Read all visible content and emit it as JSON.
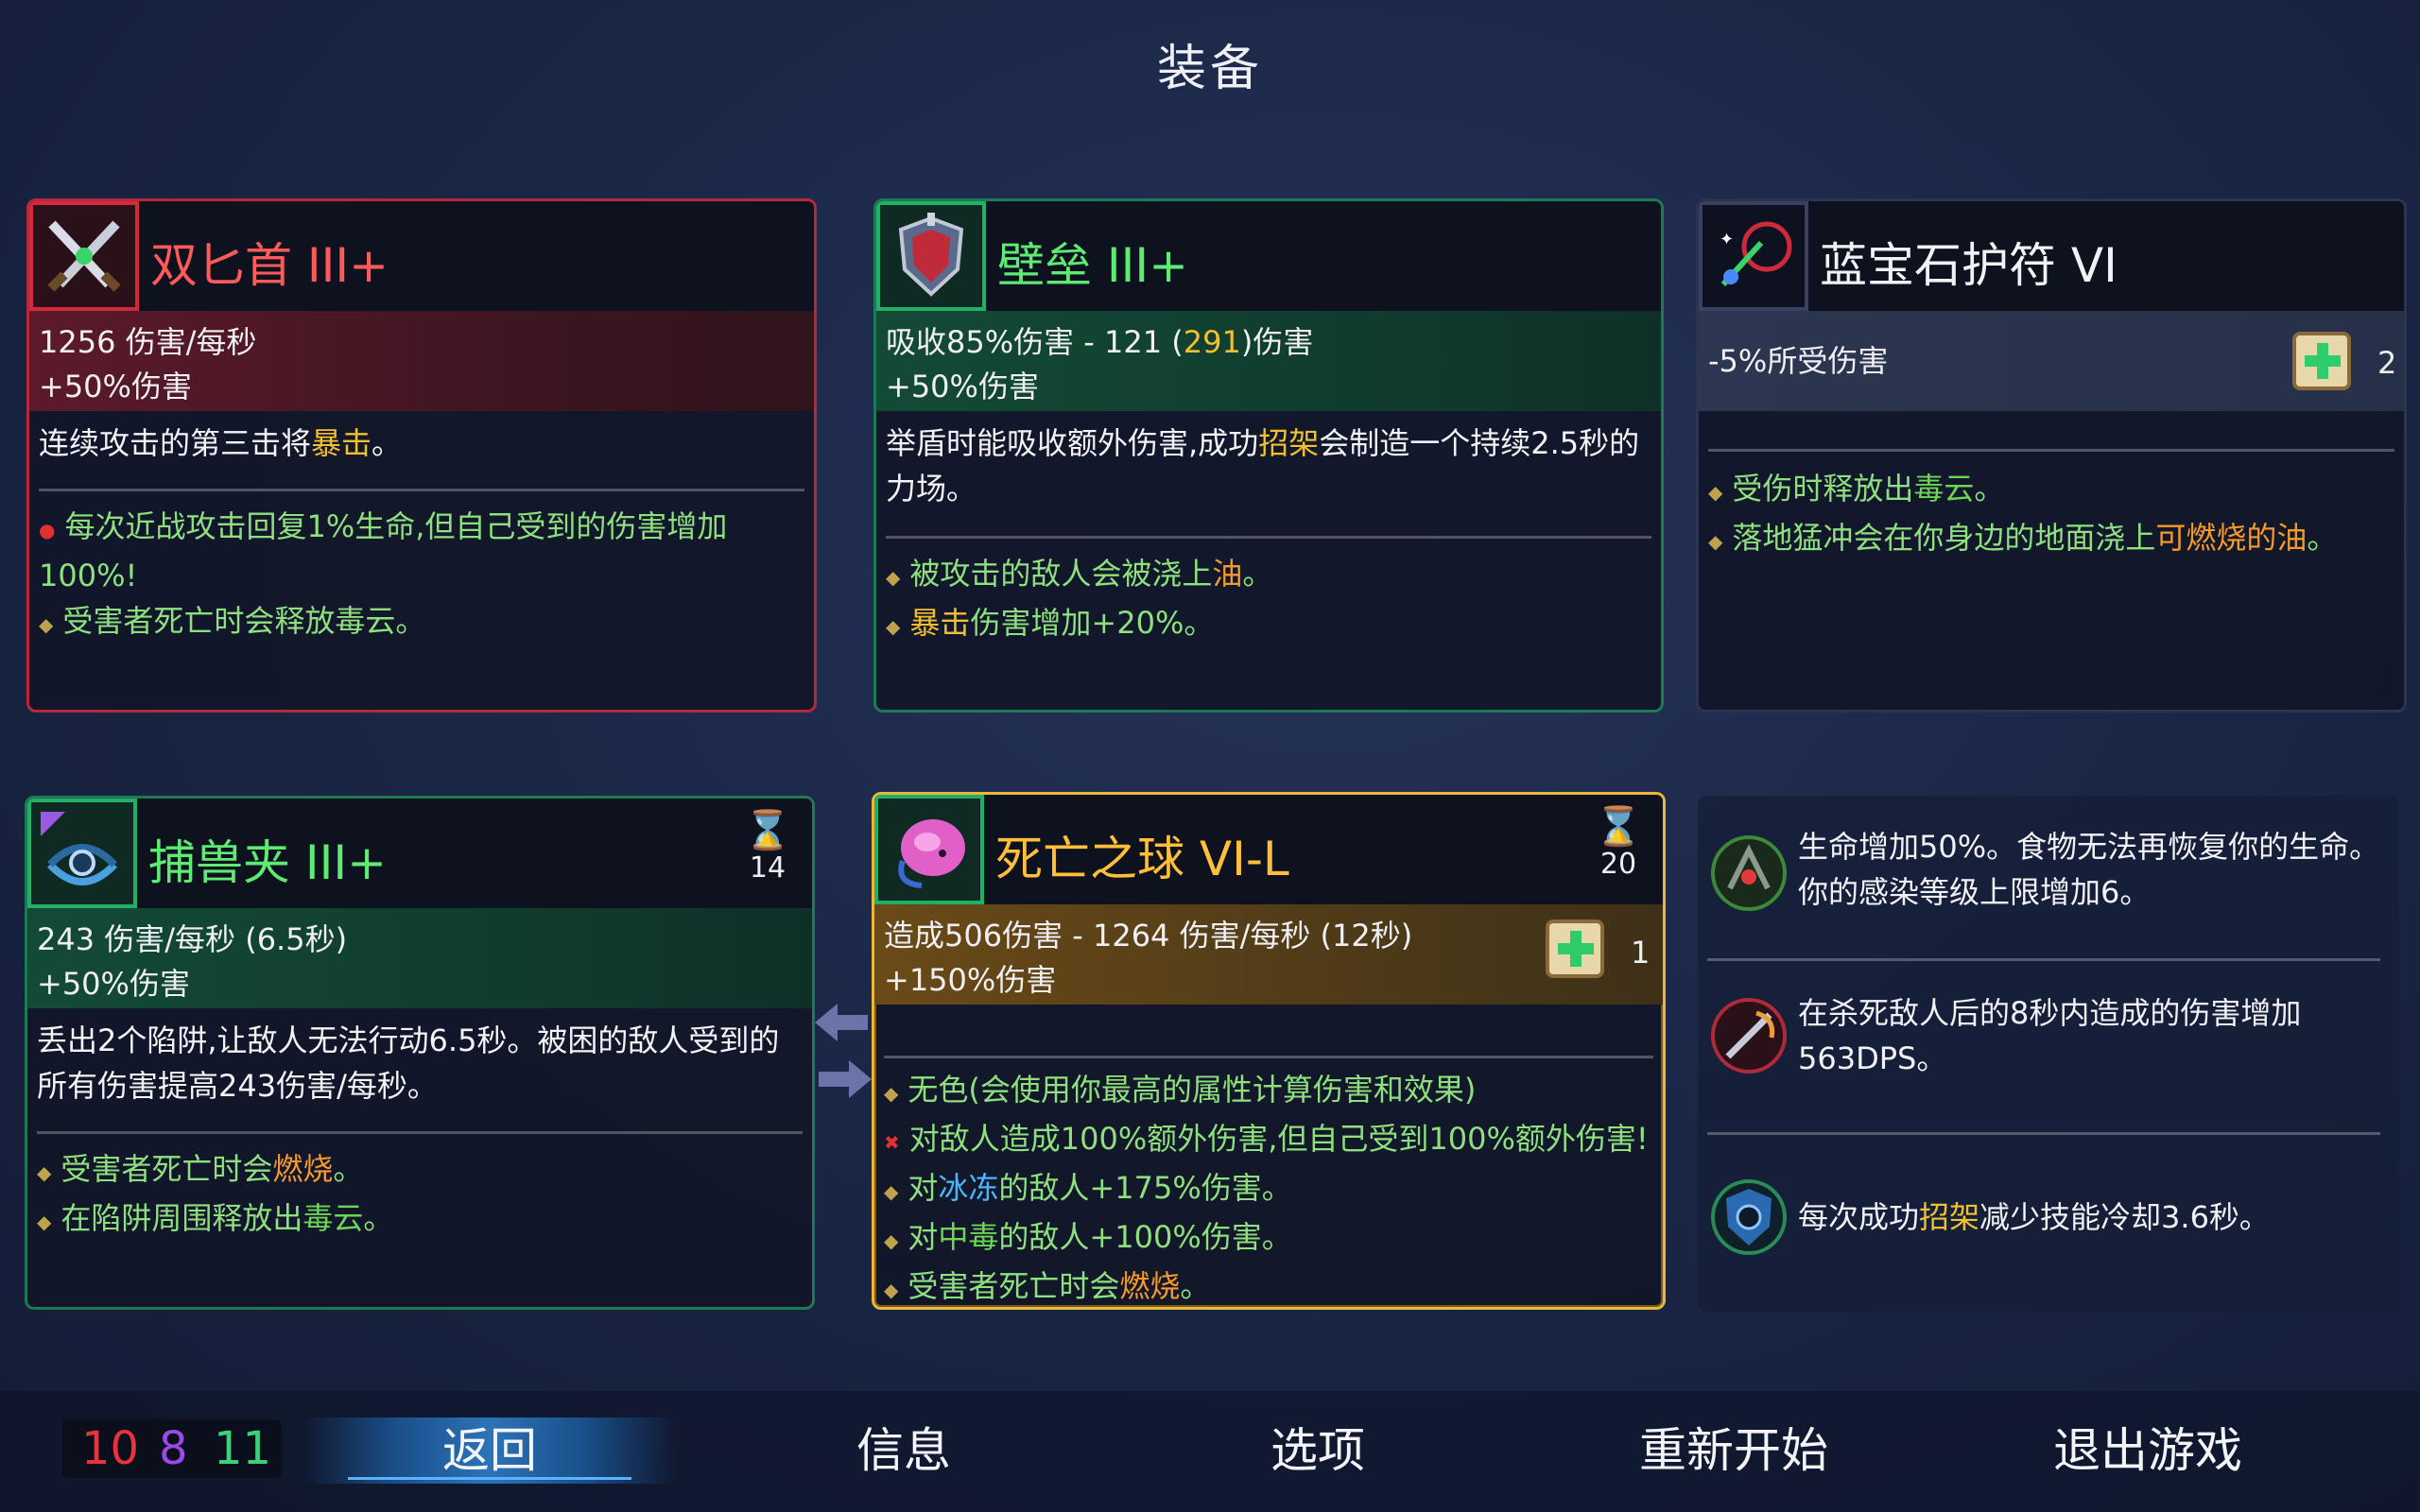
{
  "header": {
    "title": "装备"
  },
  "cards": {
    "dagger": {
      "name": "双匕首 III+",
      "stat1": "1256 伤害/每秒",
      "stat2": "+50%伤害",
      "desc_pre": "连续攻击的第三击将",
      "desc_hl": "暴击",
      "desc_post": "。",
      "aff1": "每次近战攻击回复1%生命,但自己受到的伤害增加100%!",
      "aff2": "受害者死亡时会释放毒云。"
    },
    "shield": {
      "name": "壁垒 III+",
      "stat1_pre": "吸收85%伤害 - 121 (",
      "stat1_hl": "291",
      "stat1_post": ")伤害",
      "stat2": "+50%伤害",
      "desc_pre": "举盾时能吸收额外伤害,成功",
      "desc_hl": "招架",
      "desc_post": "会制造一个持续2.5秒的力场。",
      "aff1_pre": "被攻击的敌人会被浇上",
      "aff1_hl": "油",
      "aff1_post": "。",
      "aff2_hl": "暴击",
      "aff2_post": "伤害增加+20%。"
    },
    "amulet": {
      "name": "蓝宝石护符 VI",
      "stat1": "-5%所受伤害",
      "scroll_count": "2",
      "aff1_pre": "受伤时释放出",
      "aff1_hl": "毒云",
      "aff1_post": "。",
      "aff2_pre": "落地猛冲会在你身边的地面浇上",
      "aff2_hl": "可燃烧的油",
      "aff2_post": "。"
    },
    "trap": {
      "name": "捕兽夹 III+",
      "timer": "14",
      "stat1": "243 伤害/每秒 (6.5秒)",
      "stat2": "+50%伤害",
      "desc": "丢出2个陷阱,让敌人无法行动6.5秒。被困的敌人受到的所有伤害提高243伤害/每秒。",
      "aff1_pre": "受害者死亡时会",
      "aff1_hl": "燃烧",
      "aff1_post": "。",
      "aff2_pre": "在陷阱周围释放出",
      "aff2_hl": "毒云",
      "aff2_post": "。"
    },
    "orb": {
      "name": "死亡之球 VI-L",
      "timer": "20",
      "stat1": "造成506伤害 - 1264 伤害/每秒 (12秒)",
      "stat2": "+150%伤害",
      "scroll_count": "1",
      "aff1": "无色(会使用你最高的属性计算伤害和效果)",
      "aff2": "对敌人造成100%额外伤害,但自己受到100%额外伤害!",
      "aff3_pre": "对",
      "aff3_hl": "冰冻",
      "aff3_post": "的敌人+175%伤害。",
      "aff4_pre": "对",
      "aff4_hl": "中毒",
      "aff4_post": "的敌人+100%伤害。",
      "aff5_pre": "受害者死亡时会",
      "aff5_hl": "燃烧",
      "aff5_post": "。"
    }
  },
  "mutations": {
    "m1": "生命增加50%。食物无法再恢复你的生命。你的感染等级上限增加6。",
    "m2": "在杀死敌人后的8秒内造成的伤害增加563DPS。",
    "m3_pre": "每次成功",
    "m3_hl": "招架",
    "m3_post": "减少技能冷却3.6秒。"
  },
  "stats": {
    "brutality": "10",
    "tactics": "8",
    "survival": "11"
  },
  "menu": {
    "back": "返回",
    "info": "信息",
    "options": "选项",
    "restart": "重新开始",
    "quit": "退出游戏"
  },
  "colors": {
    "brutality": "#e8323c",
    "tactics": "#9b4be8",
    "survival": "#3ed17a",
    "accent_gold": "#e8b73c"
  }
}
